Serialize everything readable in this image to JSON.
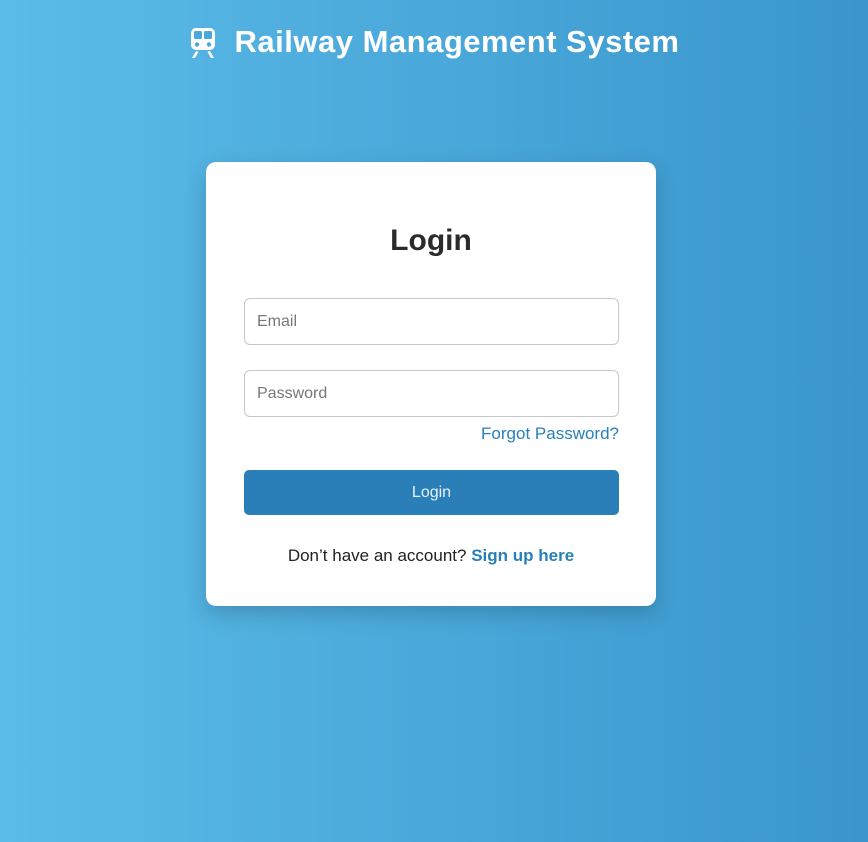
{
  "header": {
    "icon": "train-icon",
    "title": "Railway Management System"
  },
  "login": {
    "heading": "Login",
    "email": {
      "value": "",
      "placeholder": "Email"
    },
    "password": {
      "value": "",
      "placeholder": "Password"
    },
    "forgot_password": "Forgot Password?",
    "submit_label": "Login",
    "signup_prompt": "Don’t have an account?",
    "signup_link": "Sign up here"
  },
  "colors": {
    "background_start": "#5bbce8",
    "background_end": "#3a96cc",
    "accent": "#2a7fb8",
    "link": "#2880b9",
    "card": "#ffffff"
  }
}
